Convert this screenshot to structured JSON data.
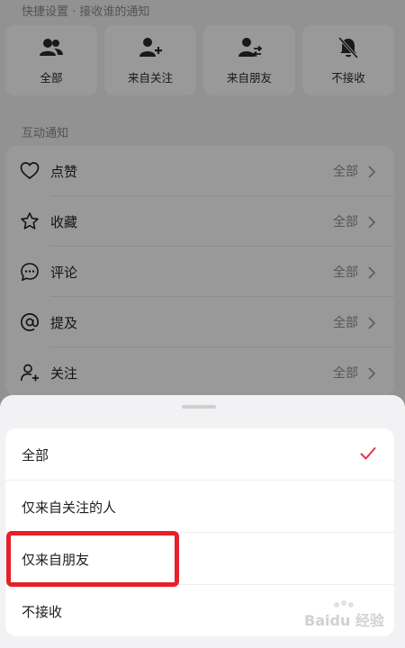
{
  "quick_settings": {
    "title": "快捷设置 · 接收谁的通知",
    "cards": [
      {
        "icon": "group-icon",
        "label": "全部"
      },
      {
        "icon": "user-add-icon",
        "label": "来自关注"
      },
      {
        "icon": "user-swap-icon",
        "label": "来自朋友"
      },
      {
        "icon": "bell-off-icon",
        "label": "不接收"
      }
    ]
  },
  "interaction": {
    "title": "互动通知",
    "rows": [
      {
        "icon": "heart-icon",
        "label": "点赞",
        "value": "全部"
      },
      {
        "icon": "star-icon",
        "label": "收藏",
        "value": "全部"
      },
      {
        "icon": "comment-icon",
        "label": "评论",
        "value": "全部"
      },
      {
        "icon": "at-icon",
        "label": "提及",
        "value": "全部"
      },
      {
        "icon": "user-plus-icon",
        "label": "关注",
        "value": "全部"
      }
    ]
  },
  "sheet": {
    "options": [
      {
        "label": "全部",
        "selected": true
      },
      {
        "label": "仅来自关注的人",
        "selected": false
      },
      {
        "label": "仅来自朋友",
        "selected": false
      },
      {
        "label": "不接收",
        "selected": false
      }
    ]
  },
  "colors": {
    "accent": "#e0344f",
    "highlight": "#e6202a"
  },
  "watermark": {
    "text": "Baidu 经验"
  }
}
